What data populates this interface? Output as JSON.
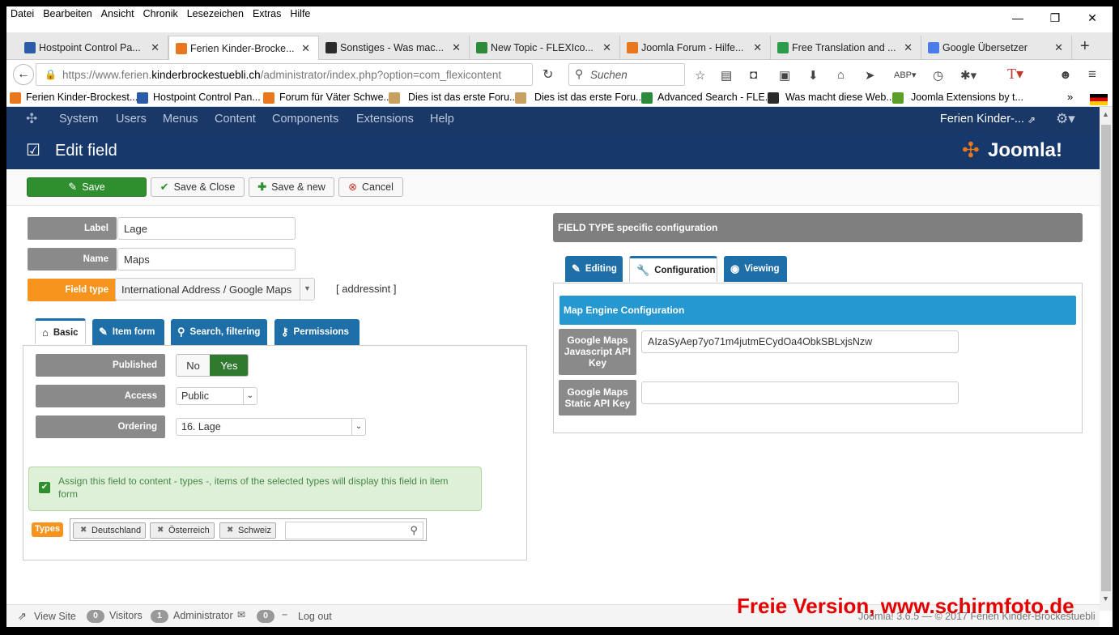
{
  "menubar": [
    "Datei",
    "Bearbeiten",
    "Ansicht",
    "Chronik",
    "Lesezeichen",
    "Extras",
    "Hilfe"
  ],
  "window_controls": {
    "minimize": "—",
    "maximize": "❐",
    "close": "✕"
  },
  "tabs": [
    {
      "label": "Hostpoint Control Pa...",
      "color": "#2a5ca8"
    },
    {
      "label": "Ferien Kinder-Brocke...",
      "color": "#e8771d"
    },
    {
      "label": "Sonstiges - Was mac...",
      "color": "#2b2b2b"
    },
    {
      "label": "New Topic - FLEXIco...",
      "color": "#2d8a3a"
    },
    {
      "label": "Joomla Forum - Hilfe...",
      "color": "#e8771d"
    },
    {
      "label": "Free Translation and ...",
      "color": "#2d9c4a"
    },
    {
      "label": "Google Übersetzer",
      "color": "#4a7de8"
    }
  ],
  "tab_new": "+",
  "url": {
    "prefix": "https://www.ferien.",
    "domain": "kinderbrockestuebli.ch",
    "path": "/administrator/index.php?option=com_flexicontent"
  },
  "search_placeholder": "Suchen",
  "bookmarks": [
    {
      "label": "Ferien Kinder-Brockest...",
      "color": "#e8771d"
    },
    {
      "label": "Hostpoint Control Pan...",
      "color": "#2a5ca8"
    },
    {
      "label": "Forum für Väter Schwe...",
      "color": "#e8771d"
    },
    {
      "label": "Dies ist das erste Foru...",
      "color": "#c8a060"
    },
    {
      "label": "Dies ist das erste Foru...",
      "color": "#c8a060"
    },
    {
      "label": "Advanced Search - FLE...",
      "color": "#2d8a3a"
    },
    {
      "label": "Was macht diese Web...",
      "color": "#2b2b2b"
    },
    {
      "label": "Joomla Extensions by t...",
      "color": "#5c9e2a"
    }
  ],
  "bookmarks_more": "»",
  "jnav": {
    "items": [
      "System",
      "Users",
      "Menus",
      "Content",
      "Components",
      "Extensions",
      "Help"
    ],
    "site": "Ferien Kinder-..."
  },
  "page_title": "Edit field",
  "brand": "Joomla!",
  "toolbar": {
    "save": "Save",
    "save_close": "Save & Close",
    "save_new": "Save & new",
    "cancel": "Cancel"
  },
  "form": {
    "label_lbl": "Label",
    "label_val": "Lage",
    "name_lbl": "Name",
    "name_val": "Maps",
    "fieldtype_lbl": "Field type",
    "fieldtype_val": "International Address / Google Maps",
    "fieldtype_code": "[ addressint ]"
  },
  "left_tabs": [
    "Basic",
    "Item form",
    "Search, filtering",
    "Permissions"
  ],
  "basic": {
    "published_lbl": "Published",
    "no": "No",
    "yes": "Yes",
    "access_lbl": "Access",
    "access_val": "Public",
    "ordering_lbl": "Ordering",
    "ordering_val": "16. Lage",
    "assign_text": "Assign this field to content - types -, items of the selected types will display this field in item form",
    "types_lbl": "Types",
    "types": [
      "Deutschland",
      "Österreich",
      "Schweiz"
    ]
  },
  "right": {
    "header": "FIELD TYPE specific configuration",
    "tabs": [
      "Editing",
      "Configuration",
      "Viewing"
    ],
    "section": "Map Engine Configuration",
    "js_key_lbl": "Google Maps Javascript API Key",
    "js_key_val": "AIzaSyAep7yo71m4jutmECydOa4ObkSBLxjsNzw",
    "static_key_lbl": "Google Maps Static API Key",
    "static_key_val": ""
  },
  "status": {
    "view_site": "View Site",
    "visitors_count": "0",
    "visitors": "Visitors",
    "admin_count": "1",
    "admin": "Administrator",
    "msg_count": "0",
    "logout": "Log out",
    "copyright": "Joomla! 3.6.5 — © 2017 Ferien Kinder-Brockestuebli"
  },
  "watermark": "Freie Version, www.schirmfoto.de"
}
